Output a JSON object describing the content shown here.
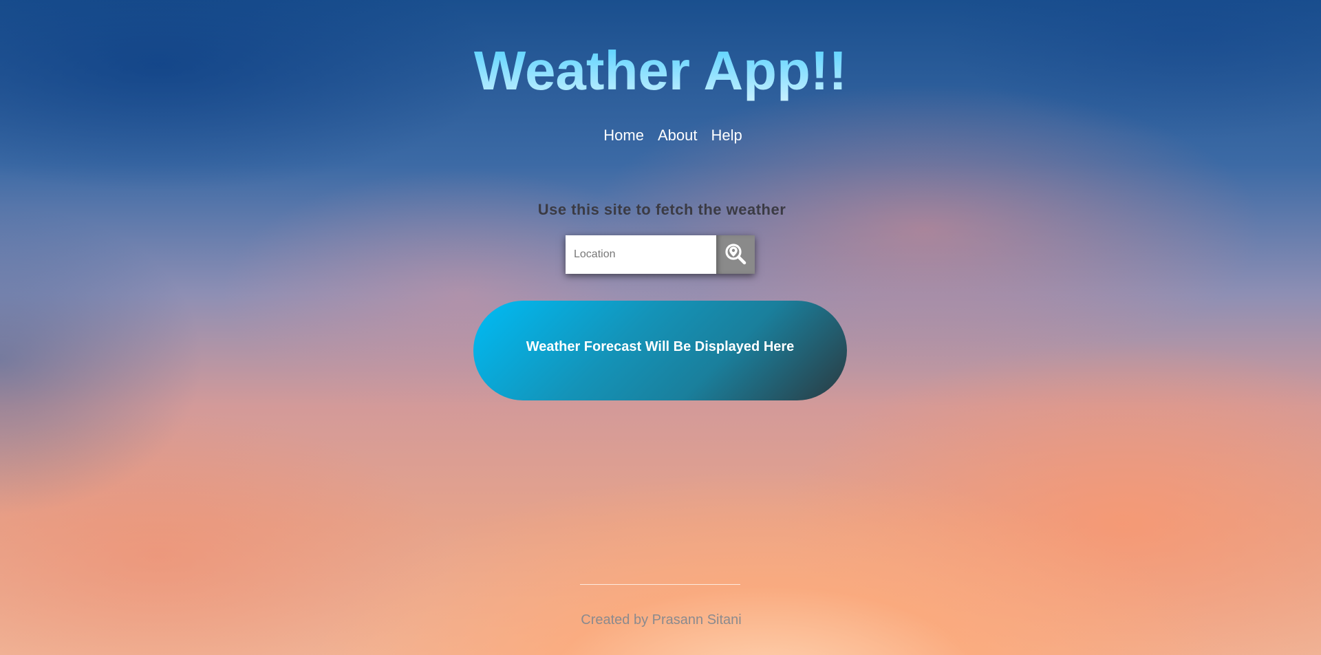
{
  "header": {
    "title": "Weather App!!"
  },
  "nav": {
    "items": [
      {
        "label": "Home"
      },
      {
        "label": "About"
      },
      {
        "label": "Help"
      }
    ]
  },
  "main": {
    "tagline": "Use this site to fetch the weather",
    "search": {
      "placeholder": "Location",
      "value": "",
      "button_icon": "location-search-icon"
    },
    "forecast": {
      "text": "Weather Forecast Will Be Displayed Here"
    }
  },
  "footer": {
    "credit": "Created by Prasann Sitani"
  },
  "colors": {
    "title_gradient_top": "#4fcfff",
    "title_gradient_bottom": "#c9f1ff",
    "forecast_gradient_start": "#00bcf5",
    "forecast_gradient_end": "#2b3a40",
    "search_button": "#8a8a8a",
    "tagline": "#3b3b44",
    "footer_text": "#8a8a8e"
  }
}
